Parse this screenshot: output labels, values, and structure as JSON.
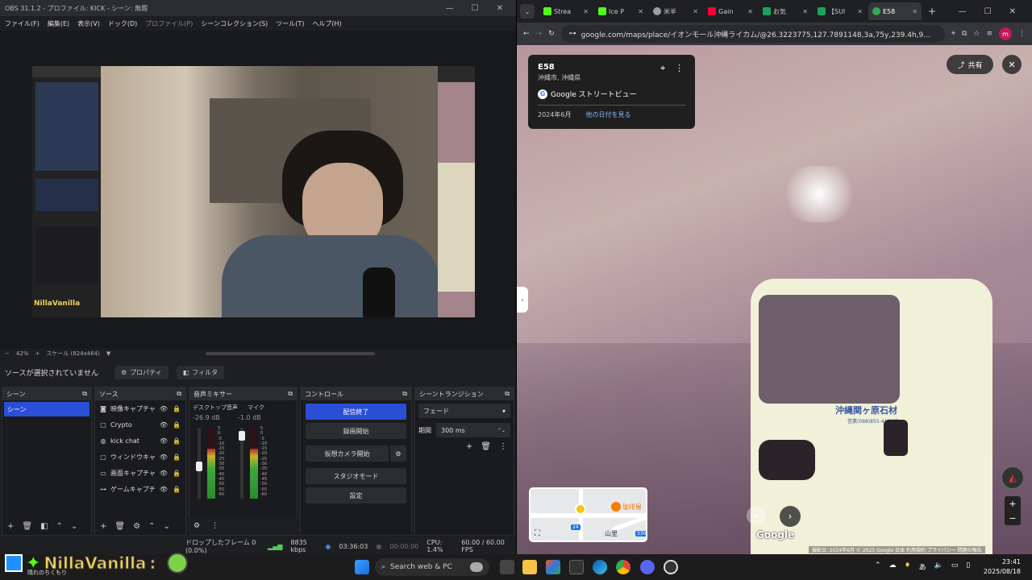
{
  "obs": {
    "title": "OBS 31.1.2 - プロファイル: KICK - シーン: 無題",
    "menu": [
      "ファイル(F)",
      "編集(E)",
      "表示(V)",
      "ドック(D)",
      "プロファイル(P)",
      "シーンコレクション(S)",
      "ツール(T)",
      "ヘルプ(H)"
    ],
    "zoom": "42%",
    "scale": "スケール (824x464)",
    "no_source": "ソースが選択されていません",
    "properties": "プロパティ",
    "filters": "フィルタ",
    "scenes": {
      "header": "シーン",
      "items": [
        "シーン"
      ]
    },
    "sources": {
      "header": "ソース",
      "items": [
        {
          "icon": "camera-icon",
          "name": "映像キャプチャ"
        },
        {
          "icon": "window-icon",
          "name": "Crypto"
        },
        {
          "icon": "globe-icon",
          "name": "kick chat"
        },
        {
          "icon": "window-icon",
          "name": "ウィンドウキャプチャ"
        },
        {
          "icon": "monitor-icon",
          "name": "画面キャプチャ"
        },
        {
          "icon": "gamepad-icon",
          "name": "ゲームキャプチャ"
        }
      ]
    },
    "mixer": {
      "header": "音声ミキサー",
      "channels": [
        {
          "name": "デスクトップ音声",
          "db": "-26.9 dB",
          "level": 0.45
        },
        {
          "name": "マイク",
          "db": "-1.0 dB",
          "level": 0.95
        }
      ],
      "scale": [
        "5",
        "0",
        "-5",
        "-10",
        "-15",
        "-20",
        "-25",
        "-30",
        "-35",
        "-40",
        "-45",
        "-50",
        "-55",
        "-60"
      ]
    },
    "controls": {
      "header": "コントロール",
      "stop_stream": "配信終了",
      "start_record": "録画開始",
      "virtual_cam": "仮想カメラ開始",
      "studio_mode": "スタジオモード",
      "settings": "設定"
    },
    "transition": {
      "header": "シーントランジション",
      "type": "フェード",
      "duration_label": "期間",
      "duration": "300 ms"
    },
    "status": {
      "dropped": "ドロップしたフレーム 0 (0.0%)",
      "bitrate": "8835 kbps",
      "stream_time": "03:36:03",
      "record_time": "00:00:00",
      "cpu": "CPU: 1.4%",
      "fps": "60.00 / 60.00 FPS"
    },
    "overlay_name": "NillaVanilla"
  },
  "chrome": {
    "tabs": [
      {
        "label": "Strea",
        "color": "#53fc18"
      },
      {
        "label": "Ice P",
        "color": "#53fc18"
      },
      {
        "label": "米半",
        "color": "#9aa0a6"
      },
      {
        "label": "Gain",
        "color": "#ff0033"
      },
      {
        "label": "お気",
        "color": "#1aa260"
      },
      {
        "label": "【SUI",
        "color": "#1aa260"
      },
      {
        "label": "E58",
        "color": "#34a853",
        "active": true
      }
    ],
    "url": "google.com/maps/place/イオンモール沖縄ライカム/@26.3223775,127.7891148,3a,75y,239.4h,9...",
    "avatar": "m",
    "streetview": {
      "place": "E58",
      "region": "沖縄市, 沖縄県",
      "brand": "Google ストリートビュー",
      "date": "2024年6月",
      "other_dates": "他の日付を見る",
      "share": "共有",
      "truck_text": "沖縄関ヶ原石材",
      "truck_phone": "営業(098)855-4100代",
      "google_logo": "Google",
      "footer": "撮影日: 2024年6月  © 2025 Google  日本  利用規約  プライバシー  問題の報告",
      "map_road": "24",
      "map_area": "山里",
      "map_poi": "珈琲屋",
      "map_road2": "330"
    }
  },
  "taskbar": {
    "search": "Search web & PC",
    "ime": "あ",
    "time": "23:41",
    "date": "2025/08/18"
  },
  "overlay": {
    "name": "NillaVanilla",
    "colon": ":",
    "sub": "晴れのちくもり"
  }
}
